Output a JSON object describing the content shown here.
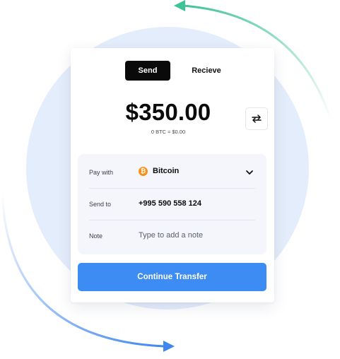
{
  "tabs": {
    "send_label": "Send",
    "receive_label": "Recieve"
  },
  "amount": {
    "value": "$350.00",
    "conversion": "0 BTC ≈ $0.00"
  },
  "pay_with": {
    "label": "Pay with",
    "coin": "Bitcoin",
    "coin_symbol": "₿",
    "icon": "bitcoin-icon"
  },
  "send_to": {
    "label": "Send to",
    "value": "+995 590 558 124"
  },
  "note": {
    "label": "Note",
    "placeholder": "Type to add a note"
  },
  "continue_button": {
    "label": "Continue Transfer"
  },
  "colors": {
    "accent": "#3c8cf3",
    "tab_active": "#0a0a0a",
    "bitcoin": "#f7931a",
    "background_circle": "#e4edfb",
    "arrow_green": "#5ccaa6",
    "arrow_blue": "#3f87ef"
  },
  "icons": [
    "swap-icon",
    "bitcoin-icon",
    "chevron-down-icon",
    "arrow-left-icon",
    "arrow-right-icon"
  ]
}
